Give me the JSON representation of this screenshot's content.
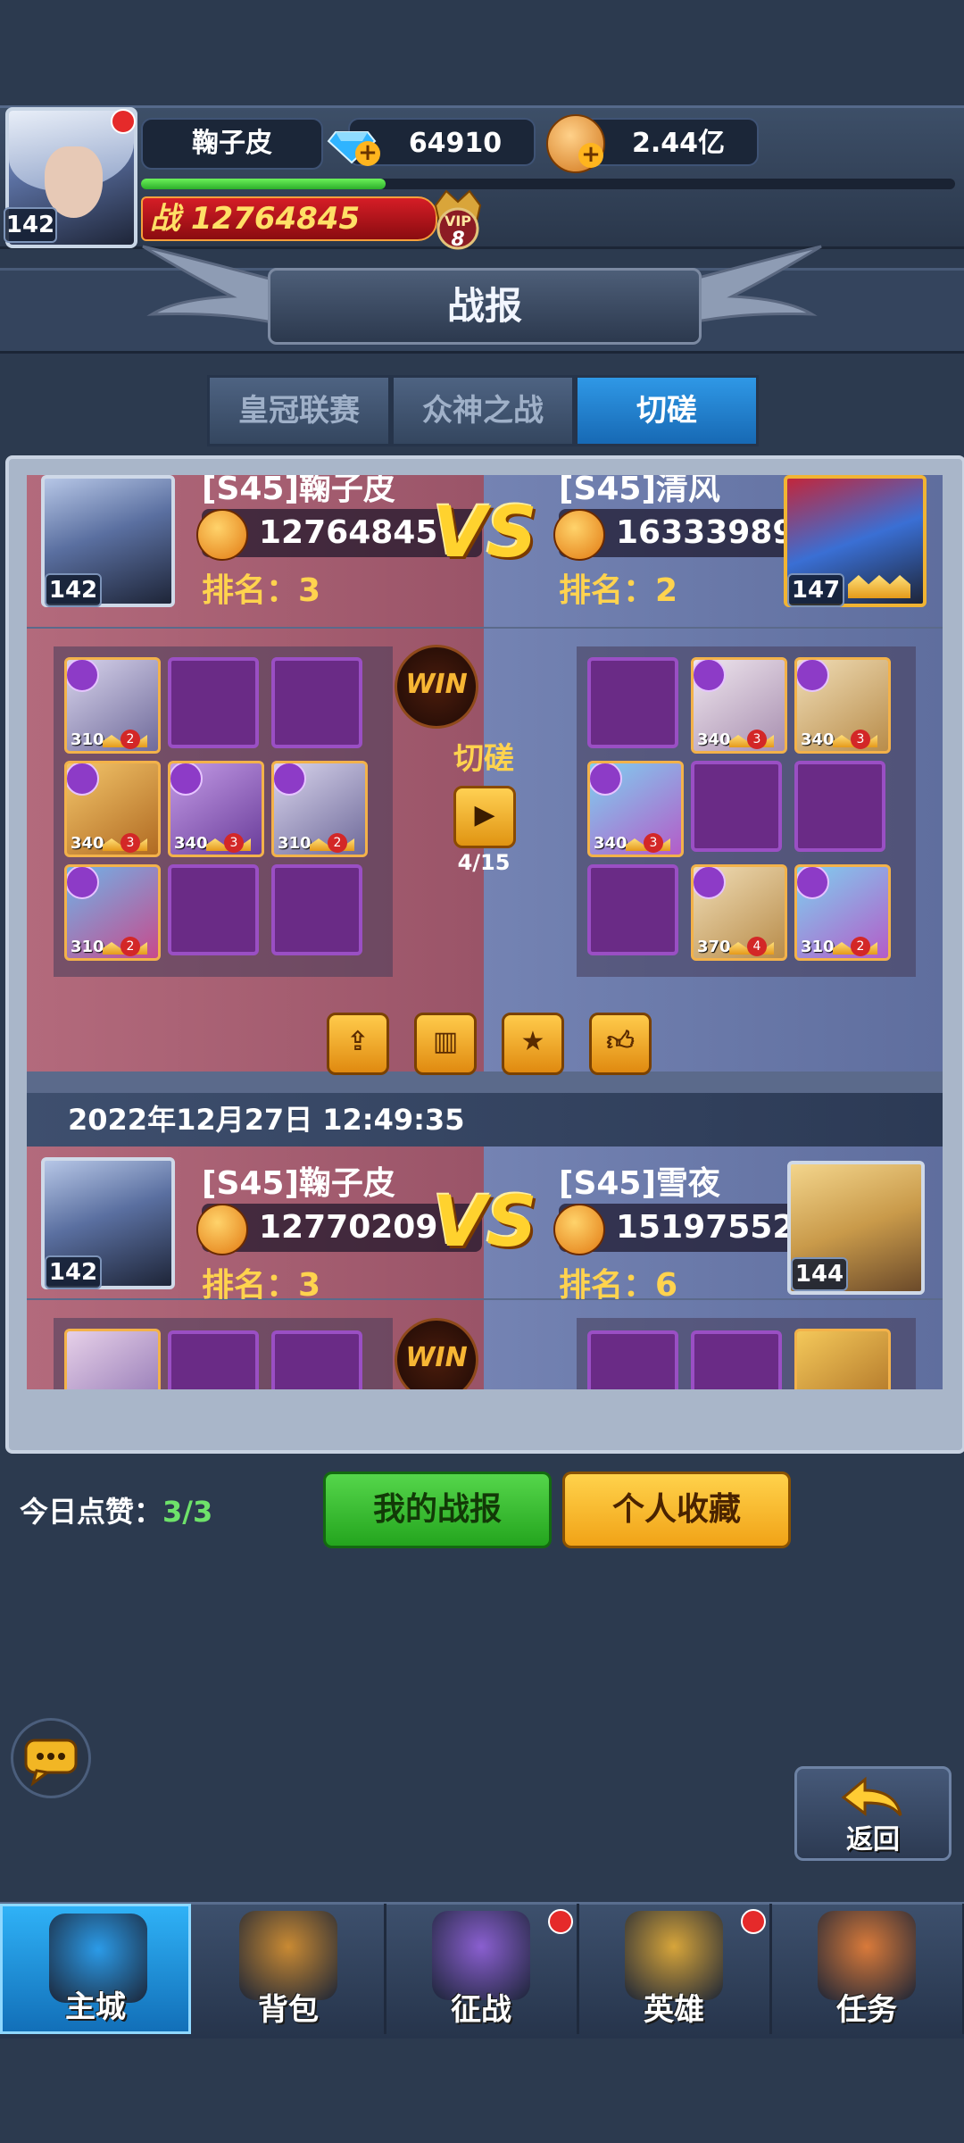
{
  "player": {
    "name": "鞠子皮",
    "level": "142",
    "diamonds": "64910",
    "gold": "2.44亿",
    "power_label": "战",
    "power": "12764845",
    "vip_label": "VIP",
    "vip_level": "8",
    "exp_progress": 0.3
  },
  "header": {
    "title": "战报"
  },
  "tabs": [
    {
      "label": "皇冠联赛",
      "active": false
    },
    {
      "label": "众神之战",
      "active": false
    },
    {
      "label": "切磋",
      "active": true
    }
  ],
  "battles": [
    {
      "left": {
        "name": "[S45]鞠子皮",
        "power": "12764845",
        "rank": "排名：3",
        "level": "142"
      },
      "right": {
        "name": "[S45]清风",
        "power": "16333989",
        "rank": "排名：2",
        "level": "147"
      },
      "vs": "VS",
      "result": "WIN",
      "mode": "切磋",
      "round": "4/15",
      "left_heroes": [
        {
          "lv": "310",
          "stars": "2"
        },
        null,
        null,
        {
          "lv": "340",
          "stars": "3"
        },
        {
          "lv": "340",
          "stars": "3"
        },
        {
          "lv": "310",
          "stars": "2"
        },
        {
          "lv": "310",
          "stars": "2"
        },
        null,
        null
      ],
      "right_heroes": [
        null,
        {
          "lv": "340",
          "stars": "3"
        },
        {
          "lv": "340",
          "stars": "3"
        },
        {
          "lv": "340",
          "stars": "3"
        },
        null,
        null,
        null,
        {
          "lv": "370",
          "stars": "4"
        },
        {
          "lv": "310",
          "stars": "2"
        }
      ]
    },
    {
      "date": "2022年12月27日 12:49:35",
      "left": {
        "name": "[S45]鞠子皮",
        "power": "12770209",
        "rank": "排名：3",
        "level": "142"
      },
      "right": {
        "name": "[S45]雪夜",
        "power": "15197552",
        "rank": "排名：6",
        "level": "144"
      },
      "vs": "VS",
      "result": "WIN"
    }
  ],
  "footer": {
    "likes_label": "今日点赞：",
    "likes_value": "3/3",
    "my_reports": "我的战报",
    "favorites": "个人收藏",
    "return_label": "返回"
  },
  "nav": [
    {
      "label": "主城",
      "icon": "castle-icon",
      "active": true,
      "badge": false
    },
    {
      "label": "背包",
      "icon": "chest-icon",
      "active": false,
      "badge": false
    },
    {
      "label": "征战",
      "icon": "portal-icon",
      "active": false,
      "badge": true
    },
    {
      "label": "英雄",
      "icon": "helmet-icon",
      "active": false,
      "badge": true
    },
    {
      "label": "任务",
      "icon": "scroll-icon",
      "active": false,
      "badge": false
    }
  ],
  "colors": {
    "accent_blue": "#1f82d2",
    "power_red": "#d51d26",
    "rank_gold": "#ffd34e",
    "green_btn": "#3cc034",
    "yellow_btn": "#f5b52a"
  }
}
